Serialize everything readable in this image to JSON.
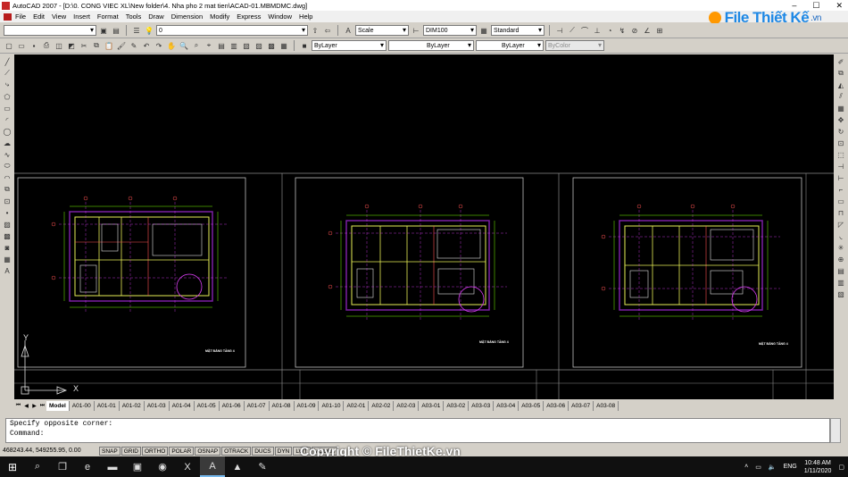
{
  "window": {
    "title": "AutoCAD 2007 - [D:\\0. CONG VIEC XL\\New folder\\4. Nha pho 2 mat tien\\ACAD-01.MBMDMC.dwg]"
  },
  "logo": {
    "text": "File Thiết Kế",
    "suffix": ".vn"
  },
  "menu": [
    "File",
    "Edit",
    "View",
    "Insert",
    "Format",
    "Tools",
    "Draw",
    "Dimension",
    "Modify",
    "Express",
    "Window",
    "Help"
  ],
  "toolbar": {
    "layer_value": "0",
    "text_style": "Scale",
    "dim_style": "DIM100",
    "table_style": "Standard",
    "color": "ByLayer",
    "linetype": "ByLayer",
    "lineweight": "ByLayer",
    "plotstyle": "ByColor"
  },
  "drawings": [
    {
      "label": "MẶT BẰNG TẦNG 4"
    },
    {
      "label": "MẶT BẰNG TẦNG 4"
    },
    {
      "label": "MẶT BẰNG TẦNG 4"
    }
  ],
  "ucs": {
    "y": "Y",
    "x": "X"
  },
  "tabs": [
    "Model",
    "A01-00",
    "A01-01",
    "A01-02",
    "A01-03",
    "A01-04",
    "A01-05",
    "A01-06",
    "A01-07",
    "A01-08",
    "A01-09",
    "A01-10",
    "A02-01",
    "A02-02",
    "A02-03",
    "A03-01",
    "A03-02",
    "A03-03",
    "A03-04",
    "A03-05",
    "A03-06",
    "A03-07",
    "A03-08"
  ],
  "command": {
    "line1": "Specify opposite corner:",
    "line2": "Command:"
  },
  "status": {
    "coords": "468243.44, 549255.95, 0.00",
    "buttons": [
      "SNAP",
      "GRID",
      "ORTHO",
      "POLAR",
      "OSNAP",
      "OTRACK",
      "DUCS",
      "DYN",
      "LWT",
      "MODEL"
    ]
  },
  "watermark": "Copyright © FileThietKe.vn",
  "taskbar": {
    "lang": "ENG",
    "time": "10:48 AM",
    "date": "1/11/2020"
  }
}
